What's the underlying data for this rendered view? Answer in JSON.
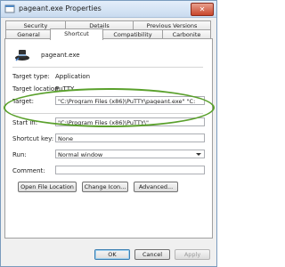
{
  "window": {
    "title": "pageant.exe Properties",
    "close_label": "✕"
  },
  "tabs_row1": [
    {
      "label": "Security"
    },
    {
      "label": "Details"
    },
    {
      "label": "Previous Versions"
    }
  ],
  "tabs_row2": [
    {
      "label": "General"
    },
    {
      "label": "Shortcut",
      "active": true
    },
    {
      "label": "Compatibility"
    },
    {
      "label": "Carbonite"
    }
  ],
  "shortcut": {
    "file_name": "pageant.exe",
    "target_type_label": "Target type:",
    "target_type_value": "Application",
    "target_location_label": "Target location:",
    "target_location_value": "PuTTY",
    "target_label": "Target:",
    "target_value": "\"C:\\Program Files (x86)\\PuTTY\\pageant.exe\" \"C:",
    "start_in_label": "Start in:",
    "start_in_value": "\"C:\\Program Files (x86)\\PuTTY\\\"",
    "shortcut_key_label": "Shortcut key:",
    "shortcut_key_value": "None",
    "run_label": "Run:",
    "run_value": "Normal window",
    "comment_label": "Comment:",
    "comment_value": "",
    "open_file_location": "Open File Location",
    "change_icon": "Change Icon...",
    "advanced": "Advanced..."
  },
  "footer": {
    "ok": "OK",
    "cancel": "Cancel",
    "apply": "Apply"
  },
  "colors": {
    "highlight_ellipse": "#5aa02c",
    "title_gradient_top": "#e4eefa",
    "close_button": "#c8462b"
  },
  "icons": [
    "app-icon",
    "pageant-hat-icon",
    "close-icon",
    "dropdown-arrow-icon"
  ]
}
